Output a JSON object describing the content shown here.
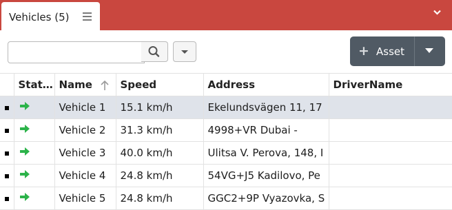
{
  "tab": {
    "label": "Vehicles (5)"
  },
  "search": {
    "placeholder": "",
    "value": ""
  },
  "asset_button": {
    "label": "Asset"
  },
  "table": {
    "columns": [
      "Stat…",
      "Name",
      "Speed",
      "Address",
      "DriverName"
    ],
    "sorted_column": "Name",
    "sort_direction": "ascending",
    "selected_row": 0,
    "rows": [
      {
        "name": "Vehicle 1",
        "speed": "15.1 km/h",
        "address": "Ekelundsvägen 11, 17",
        "driver": ""
      },
      {
        "name": "Vehicle 2",
        "speed": "31.3 km/h",
        "address": "4998+VR Dubai -",
        "driver": ""
      },
      {
        "name": "Vehicle 3",
        "speed": "40.0 km/h",
        "address": "Ulitsa V. Perova, 148, I",
        "driver": ""
      },
      {
        "name": "Vehicle 4",
        "speed": "24.8 km/h",
        "address": "54VG+J5 Kadilovo, Pe",
        "driver": ""
      },
      {
        "name": "Vehicle 5",
        "speed": "24.8 km/h",
        "address": "GGC2+9P Vyazovka, S",
        "driver": ""
      }
    ]
  },
  "colors": {
    "header_bar": "#c9473f",
    "status_arrow": "#2cb34a",
    "asset_button": "#505a64",
    "selected_row": "#dfe3ea"
  }
}
